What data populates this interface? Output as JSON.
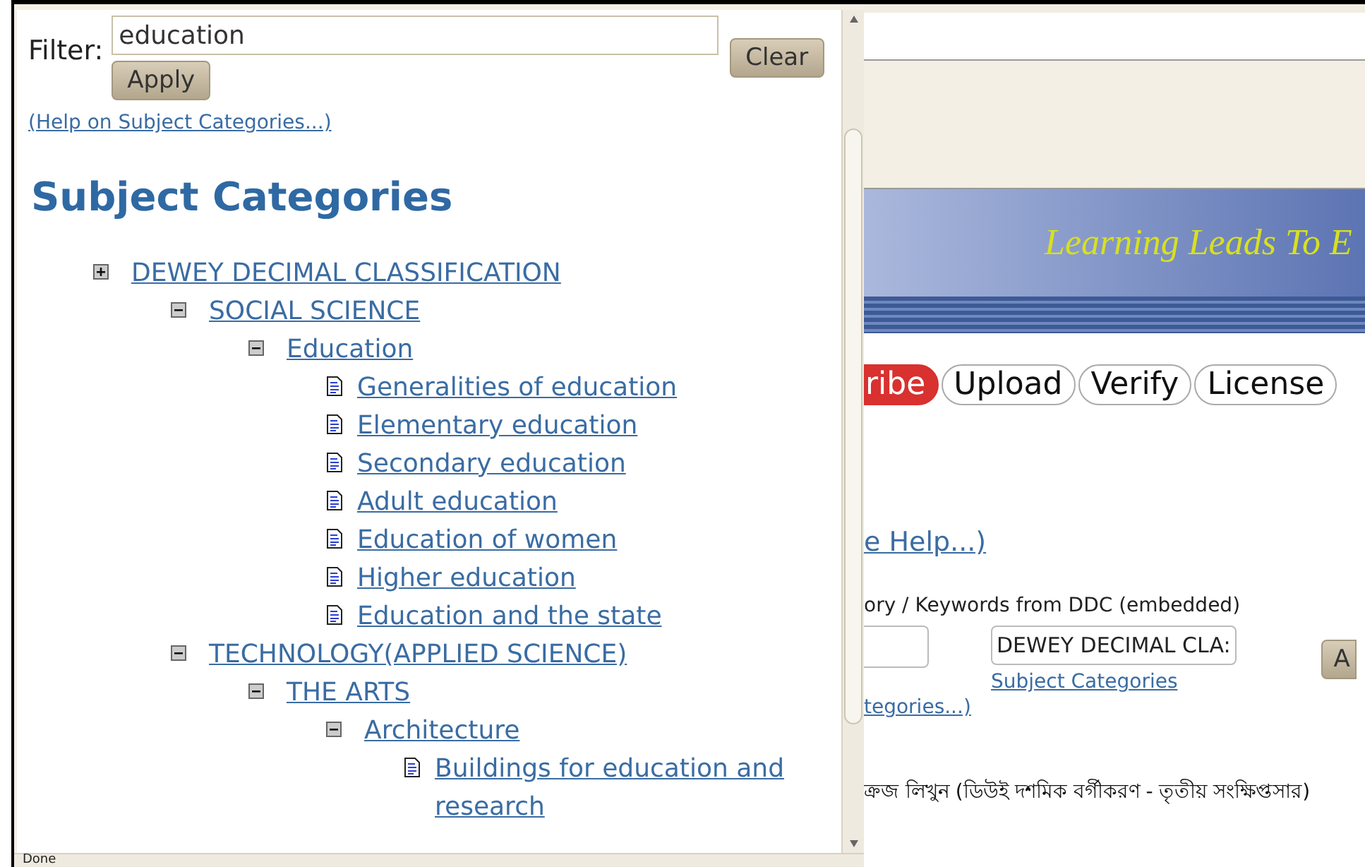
{
  "popup": {
    "filter": {
      "label": "Filter:",
      "value": "education",
      "apply": "Apply",
      "clear": "Clear"
    },
    "help_link": "(Help on Subject Categories...)",
    "heading": "Subject Categories",
    "tree": [
      {
        "kind": "category",
        "label": "DEWEY DECIMAL CLASSIFICATION",
        "expanded": false,
        "children": [
          {
            "kind": "category",
            "label": "SOCIAL SCIENCE",
            "expanded": true,
            "children": [
              {
                "kind": "category",
                "label": "Education",
                "expanded": true,
                "children": [
                  {
                    "kind": "leaf",
                    "label": "Generalities of education"
                  },
                  {
                    "kind": "leaf",
                    "label": "Elementary education"
                  },
                  {
                    "kind": "leaf",
                    "label": "Secondary education"
                  },
                  {
                    "kind": "leaf",
                    "label": "Adult education"
                  },
                  {
                    "kind": "leaf",
                    "label": "Education of women"
                  },
                  {
                    "kind": "leaf",
                    "label": "Higher education"
                  },
                  {
                    "kind": "leaf",
                    "label": "Education and the state"
                  }
                ]
              }
            ]
          },
          {
            "kind": "category",
            "label": "TECHNOLOGY(APPLIED SCIENCE)",
            "expanded": true,
            "children": [
              {
                "kind": "category",
                "label": "THE ARTS",
                "expanded": true,
                "children": [
                  {
                    "kind": "category",
                    "label": "Architecture",
                    "expanded": true,
                    "children": [
                      {
                        "kind": "leaf",
                        "label": "Buildings for education and research"
                      }
                    ]
                  }
                ]
              }
            ]
          }
        ]
      }
    ],
    "status_bar": "Done"
  },
  "page": {
    "banner": "Learning Leads To E",
    "tabs": [
      {
        "label": "ribe",
        "selected": true
      },
      {
        "label": "Upload",
        "selected": false
      },
      {
        "label": "Verify",
        "selected": false
      },
      {
        "label": "License",
        "selected": false
      }
    ],
    "help_link": "e Help...)",
    "field_label": "ory / Keywords from DDC (embedded)",
    "category_value": "DEWEY DECIMAL CLA:",
    "subject_link": "Subject Categories",
    "apply_button": "A",
    "categories_link": "tegories...)",
    "bengali_text": "ক্রজ লিখুন (ডিউই দশমিক বর্গীকরণ - তৃতীয় সংক্ষিপ্তসার)"
  }
}
